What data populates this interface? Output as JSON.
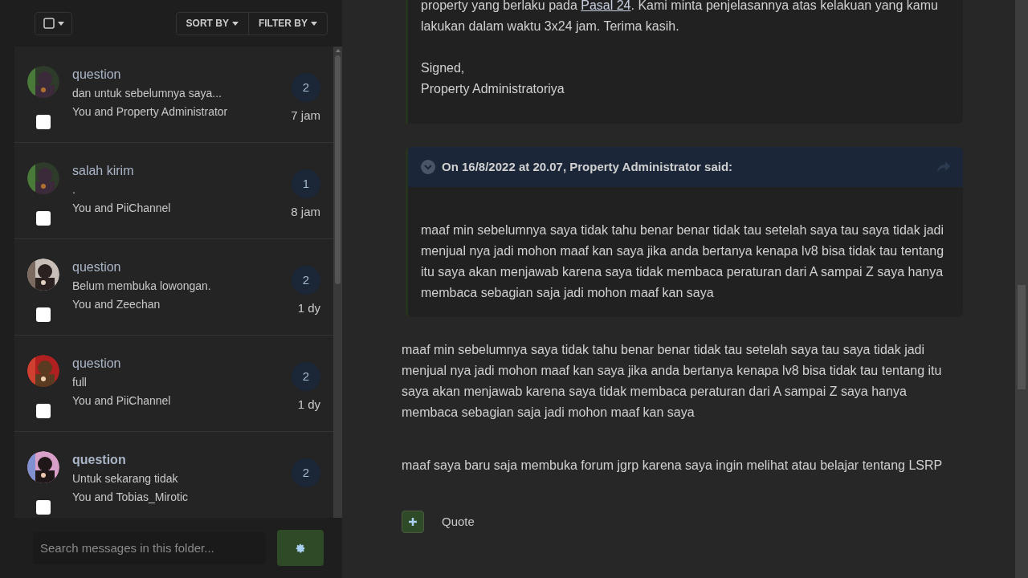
{
  "sidebar": {
    "select_all": {
      "checked": false
    },
    "sort_button": "SORT BY",
    "filter_button": "FILTER BY",
    "conversations": [
      {
        "title": "question",
        "unread": false,
        "snippet": "dan untuk sebelumnya saya...",
        "participants": "You and Property Administrator",
        "count": "2",
        "time": "7 jam",
        "checked": false
      },
      {
        "title": "salah kirim",
        "unread": false,
        "snippet": ".",
        "participants": "You and PiiChannel",
        "count": "1",
        "time": "8 jam",
        "checked": false
      },
      {
        "title": "question",
        "unread": false,
        "snippet": "Belum membuka lowongan.",
        "participants": "You and Zeechan",
        "count": "2",
        "time": "1 dy",
        "checked": false
      },
      {
        "title": "question",
        "unread": false,
        "snippet": "full",
        "participants": "You and PiiChannel",
        "count": "2",
        "time": "1 dy",
        "checked": false
      },
      {
        "title": "question",
        "unread": true,
        "snippet": "Untuk sekarang tidak",
        "participants": "You and Tobias_Mirotic",
        "count": "2",
        "checked": false
      }
    ],
    "search": {
      "placeholder": "Search messages in this folder..."
    }
  },
  "message": {
    "quote": {
      "before": "property yang berlaku pada ",
      "link": "Pasal 24",
      "after": ". Kami minta penjelasannya atas kelakuan yang kamu lakukan dalam waktu 3x24 jam. Terima kasih.",
      "signature": [
        "Signed,",
        "Property Administratoriya"
      ]
    },
    "quote_2": {
      "header": "On 16/8/2022 at 20.07, Property Administrator said:",
      "body": "maaf min sebelumnya saya tidak tahu benar benar tidak tau setelah saya tau saya tidak jadi menjual nya jadi mohon maaf kan saya jika anda bertanya kenapa lv8 bisa tidak tau tentang itu saya akan menjawab karena saya tidak membaca peraturan dari A sampai Z saya hanya membaca sebagian saja jadi mohon maaf kan saya"
    },
    "paragraphs": [
      "maaf min sebelumnya saya tidak tahu benar benar tidak tau setelah saya tau saya tidak jadi menjual nya jadi mohon maaf kan saya jika anda bertanya kenapa lv8 bisa tidak tau tentang itu saya akan menjawab karena saya tidak membaca peraturan dari A sampai Z saya hanya membaca sebagian saja jadi mohon maaf kan saya",
      "maaf saya baru saja membuka forum jgrp karena saya ingin melihat atau belajar tentang LSRP"
    ],
    "quote_button": "Quote"
  }
}
